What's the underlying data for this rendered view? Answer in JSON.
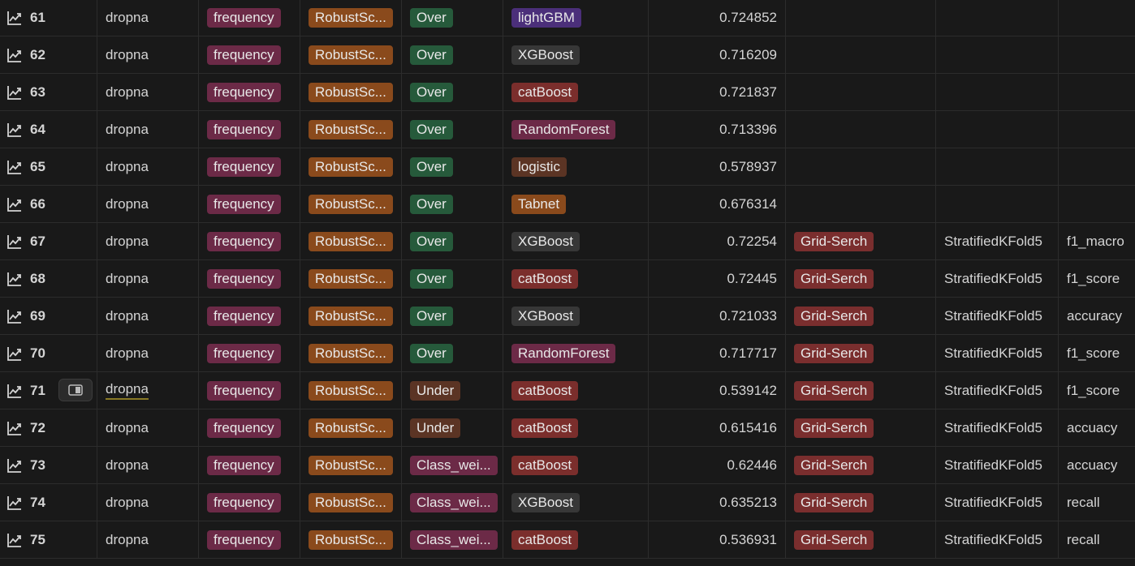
{
  "colors": {
    "background": "#191919",
    "tag_pink": "#6c2a47",
    "tag_orange": "#8a4a1c",
    "tag_green": "#265a3b",
    "tag_brown": "#5b3424",
    "tag_purple": "#4b2f7a",
    "tag_gray": "#373737",
    "tag_red": "#7a2e2e"
  },
  "icons": {
    "row_page": "chart-line-icon",
    "open_peek": "open-peek-icon"
  },
  "rows": [
    {
      "num": "61",
      "fill": "dropna",
      "encoding": "frequency",
      "scaler": "RobustSc...",
      "sampling": "Over",
      "sampling_color": "green",
      "model": "lightGBM",
      "model_color": "purple",
      "score": "0.724852",
      "tuning": "",
      "cv": "",
      "metric": ""
    },
    {
      "num": "62",
      "fill": "dropna",
      "encoding": "frequency",
      "scaler": "RobustSc...",
      "sampling": "Over",
      "sampling_color": "green",
      "model": "XGBoost",
      "model_color": "gray",
      "score": "0.716209",
      "tuning": "",
      "cv": "",
      "metric": ""
    },
    {
      "num": "63",
      "fill": "dropna",
      "encoding": "frequency",
      "scaler": "RobustSc...",
      "sampling": "Over",
      "sampling_color": "green",
      "model": "catBoost",
      "model_color": "red",
      "score": "0.721837",
      "tuning": "",
      "cv": "",
      "metric": ""
    },
    {
      "num": "64",
      "fill": "dropna",
      "encoding": "frequency",
      "scaler": "RobustSc...",
      "sampling": "Over",
      "sampling_color": "green",
      "model": "RandomForest",
      "model_color": "pink",
      "score": "0.713396",
      "tuning": "",
      "cv": "",
      "metric": ""
    },
    {
      "num": "65",
      "fill": "dropna",
      "encoding": "frequency",
      "scaler": "RobustSc...",
      "sampling": "Over",
      "sampling_color": "green",
      "model": "logistic",
      "model_color": "brown",
      "score": "0.578937",
      "tuning": "",
      "cv": "",
      "metric": ""
    },
    {
      "num": "66",
      "fill": "dropna",
      "encoding": "frequency",
      "scaler": "RobustSc...",
      "sampling": "Over",
      "sampling_color": "green",
      "model": "Tabnet",
      "model_color": "orange",
      "score": "0.676314",
      "tuning": "",
      "cv": "",
      "metric": ""
    },
    {
      "num": "67",
      "fill": "dropna",
      "encoding": "frequency",
      "scaler": "RobustSc...",
      "sampling": "Over",
      "sampling_color": "green",
      "model": "XGBoost",
      "model_color": "gray",
      "score": "0.72254",
      "tuning": "Grid-Serch",
      "cv": "StratifiedKFold5",
      "metric": "f1_macro"
    },
    {
      "num": "68",
      "fill": "dropna",
      "encoding": "frequency",
      "scaler": "RobustSc...",
      "sampling": "Over",
      "sampling_color": "green",
      "model": "catBoost",
      "model_color": "red",
      "score": "0.72445",
      "tuning": "Grid-Serch",
      "cv": "StratifiedKFold5",
      "metric": "f1_score"
    },
    {
      "num": "69",
      "fill": "dropna",
      "encoding": "frequency",
      "scaler": "RobustSc...",
      "sampling": "Over",
      "sampling_color": "green",
      "model": "XGBoost",
      "model_color": "gray",
      "score": "0.721033",
      "tuning": "Grid-Serch",
      "cv": "StratifiedKFold5",
      "metric": "accuracy"
    },
    {
      "num": "70",
      "fill": "dropna",
      "encoding": "frequency",
      "scaler": "RobustSc...",
      "sampling": "Over",
      "sampling_color": "green",
      "model": "RandomForest",
      "model_color": "pink",
      "score": "0.717717",
      "tuning": "Grid-Serch",
      "cv": "StratifiedKFold5",
      "metric": "f1_score"
    },
    {
      "num": "71",
      "fill": "dropna",
      "encoding": "frequency",
      "scaler": "RobustSc...",
      "sampling": "Under",
      "sampling_color": "brown",
      "model": "catBoost",
      "model_color": "red",
      "score": "0.539142",
      "tuning": "Grid-Serch",
      "cv": "StratifiedKFold5",
      "metric": "f1_score",
      "hovered": true
    },
    {
      "num": "72",
      "fill": "dropna",
      "encoding": "frequency",
      "scaler": "RobustSc...",
      "sampling": "Under",
      "sampling_color": "brown",
      "model": "catBoost",
      "model_color": "red",
      "score": "0.615416",
      "tuning": "Grid-Serch",
      "cv": "StratifiedKFold5",
      "metric": "accuacy"
    },
    {
      "num": "73",
      "fill": "dropna",
      "encoding": "frequency",
      "scaler": "RobustSc...",
      "sampling": "Class_wei...",
      "sampling_color": "pink",
      "model": "catBoost",
      "model_color": "red",
      "score": "0.62446",
      "tuning": "Grid-Serch",
      "cv": "StratifiedKFold5",
      "metric": "accuacy"
    },
    {
      "num": "74",
      "fill": "dropna",
      "encoding": "frequency",
      "scaler": "RobustSc...",
      "sampling": "Class_wei...",
      "sampling_color": "pink",
      "model": "XGBoost",
      "model_color": "gray",
      "score": "0.635213",
      "tuning": "Grid-Serch",
      "cv": "StratifiedKFold5",
      "metric": "recall"
    },
    {
      "num": "75",
      "fill": "dropna",
      "encoding": "frequency",
      "scaler": "RobustSc...",
      "sampling": "Class_wei...",
      "sampling_color": "pink",
      "model": "catBoost",
      "model_color": "red",
      "score": "0.536931",
      "tuning": "Grid-Serch",
      "cv": "StratifiedKFold5",
      "metric": "recall"
    }
  ]
}
